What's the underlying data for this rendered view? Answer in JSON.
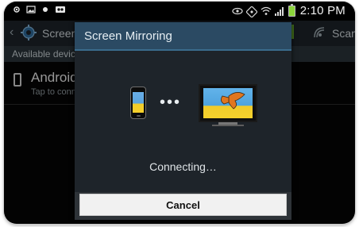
{
  "statusbar": {
    "time": "2:10 PM",
    "left_icons": [
      "settings-status-icon",
      "image-icon",
      "dot-icon",
      "voicemail-icon"
    ],
    "right_icons": [
      "eye-icon",
      "nfc-icon",
      "wifi-icon",
      "signal-icon",
      "battery-icon"
    ]
  },
  "actionbar": {
    "title": "Screen Mirroring",
    "scan_label": "Scan"
  },
  "section": {
    "header": "Available devices"
  },
  "device_list": {
    "items": [
      {
        "title": "Android",
        "subtitle": "Tap to connect"
      }
    ]
  },
  "dialog": {
    "title": "Screen Mirroring",
    "dots": "•••",
    "status": "Connecting…",
    "cancel_label": "Cancel"
  },
  "colors": {
    "dialog_title_bg": "#2b4a63",
    "dialog_body_bg": "#1e242a",
    "button_bg": "#f1f1f1",
    "battery_fill": "#8bd43b"
  }
}
